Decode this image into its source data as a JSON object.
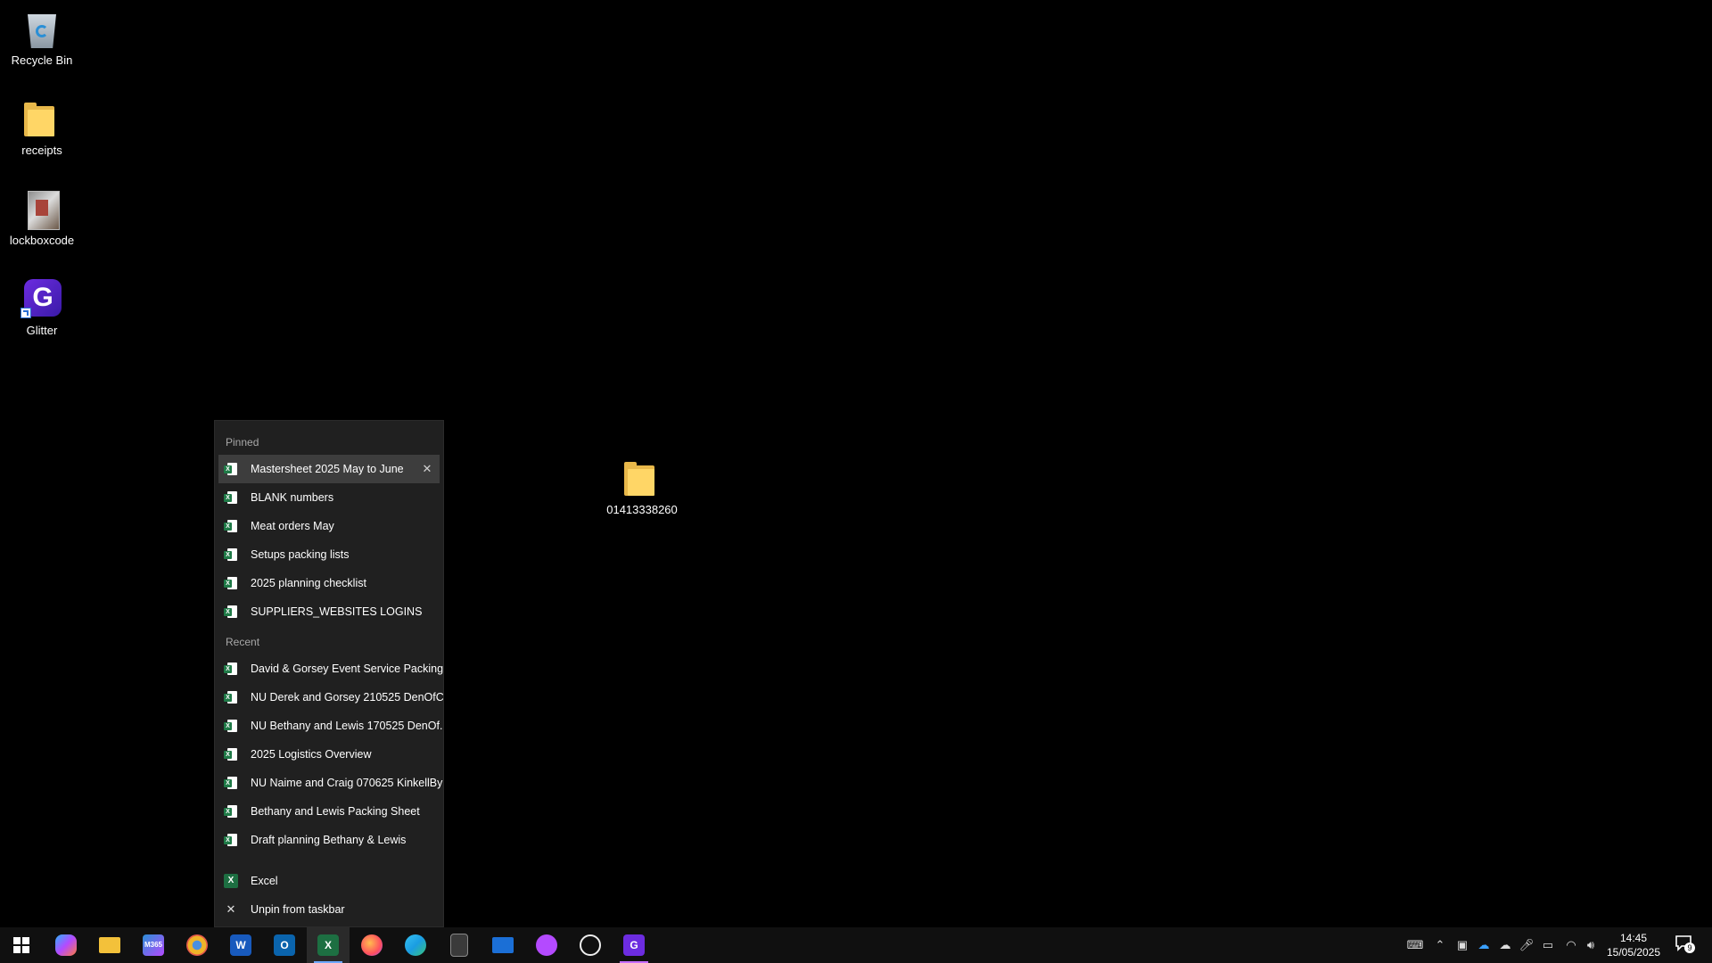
{
  "desktop": {
    "icons": [
      {
        "label": "Recycle Bin"
      },
      {
        "label": "receipts"
      },
      {
        "label": "lockboxcode"
      },
      {
        "label": "Glitter"
      },
      {
        "label": "01413338260"
      }
    ]
  },
  "jumplist": {
    "pinned_header": "Pinned",
    "pinned": [
      {
        "label": "Mastersheet 2025 May to June"
      },
      {
        "label": "BLANK numbers"
      },
      {
        "label": "Meat orders May"
      },
      {
        "label": "Setups packing lists"
      },
      {
        "label": "2025 planning checklist"
      },
      {
        "label": "SUPPLIERS_WEBSITES LOGINS"
      }
    ],
    "recent_header": "Recent",
    "recent": [
      {
        "label": "David & Gorsey Event Service Packing..."
      },
      {
        "label": "NU Derek and Gorsey 210525 DenOfC..."
      },
      {
        "label": "NU Bethany and Lewis 170525 DenOf..."
      },
      {
        "label": "2025 Logistics Overview"
      },
      {
        "label": "NU Naime and Craig 070625 KinkellByre"
      },
      {
        "label": "Bethany and Lewis Packing Sheet"
      },
      {
        "label": "Draft planning Bethany & Lewis"
      }
    ],
    "app_label": "Excel",
    "unpin_label": "Unpin from taskbar"
  },
  "taskbar": {
    "app_glyphs": {
      "word": "W",
      "outlook": "O",
      "excel": "X",
      "glitter": "G",
      "m365": "M365"
    },
    "clock": {
      "time": "14:45",
      "date": "15/05/2025"
    },
    "notification_count": "9"
  },
  "colors": {
    "excel_green": "#1d6f42",
    "accent_blue": "#6ea8ff",
    "glitter_purple": "#6c2ce0"
  }
}
